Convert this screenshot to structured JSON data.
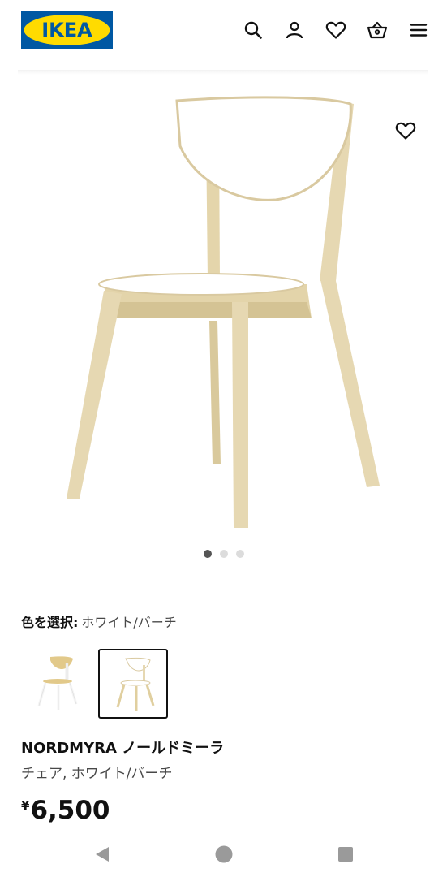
{
  "header": {
    "logo_text": "IKEA",
    "icons": [
      "search-icon",
      "user-icon",
      "heart-icon",
      "basket-icon",
      "menu-icon"
    ]
  },
  "gallery": {
    "slide_count": 3,
    "active_slide": 1
  },
  "color_select": {
    "label": "色を選択:",
    "value": "ホワイト/バーチ"
  },
  "product": {
    "name": "NORDMYRA ノールドミーラ",
    "description": "チェア, ホワイト/バーチ",
    "currency": "¥",
    "price": "6,500"
  },
  "colors": {
    "ikea_blue": "#0058a3",
    "ikea_yellow": "#ffdb00",
    "birch": "#e6d8b2",
    "text_primary": "#111111",
    "text_secondary": "#484848"
  }
}
